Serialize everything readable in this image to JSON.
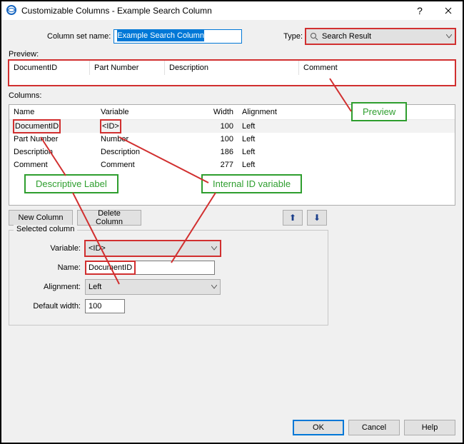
{
  "window": {
    "title": "Customizable Columns - Example Search Column"
  },
  "top": {
    "column_set_name_label": "Column set name:",
    "column_set_name_value": "Example Search Column",
    "type_label": "Type:",
    "type_value": "Search Result"
  },
  "preview": {
    "label": "Preview:",
    "headers": [
      "DocumentID",
      "Part Number",
      "Description",
      "Comment"
    ]
  },
  "columns": {
    "label": "Columns:",
    "headers": {
      "name": "Name",
      "variable": "Variable",
      "width": "Width",
      "alignment": "Alignment"
    },
    "rows": [
      {
        "name": "DocumentID",
        "variable": "<ID>",
        "width": "100",
        "alignment": "Left"
      },
      {
        "name": "Part Number",
        "variable": "Number",
        "width": "100",
        "alignment": "Left"
      },
      {
        "name": "Description",
        "variable": "Description",
        "width": "186",
        "alignment": "Left"
      },
      {
        "name": "Comment",
        "variable": "Comment",
        "width": "277",
        "alignment": "Left"
      }
    ]
  },
  "buttons": {
    "new_column": "New Column",
    "delete_column": "Delete Column",
    "ok": "OK",
    "cancel": "Cancel",
    "help": "Help"
  },
  "selected_column": {
    "legend": "Selected column",
    "variable_label": "Variable:",
    "variable_value": "<ID>",
    "name_label": "Name:",
    "name_value": "DocumentID",
    "alignment_label": "Alignment:",
    "alignment_value": "Left",
    "default_width_label": "Default width:",
    "default_width_value": "100"
  },
  "callouts": {
    "preview": "Preview",
    "descriptive_label": "Descriptive Label",
    "internal_id": "Internal ID variable"
  },
  "colors": {
    "red": "#d12f2f",
    "green": "#2e9e2e",
    "highlight": "#0078d7"
  }
}
